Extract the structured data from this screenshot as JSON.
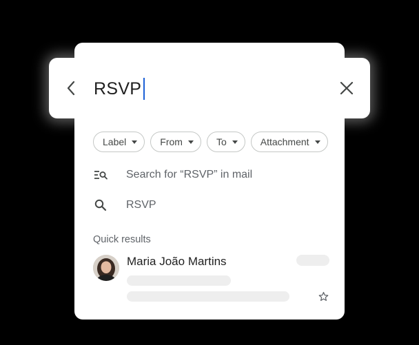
{
  "search": {
    "query": "RSVP",
    "back_icon": "arrow-back-icon",
    "clear_icon": "close-icon"
  },
  "chips": [
    {
      "label": "Label"
    },
    {
      "label": "From"
    },
    {
      "label": "To"
    },
    {
      "label": "Attachment"
    }
  ],
  "suggestions": {
    "mail_search": "Search for “RSVP” in mail",
    "query_suggestion": "RSVP"
  },
  "quick_results": {
    "heading": "Quick results",
    "items": [
      {
        "name": "Maria João Martins",
        "starred": false
      }
    ]
  },
  "colors": {
    "caret": "#1a5fd6",
    "text_primary": "#1f1f1f",
    "text_secondary": "#5f6368",
    "skeleton": "#eeeeee"
  }
}
